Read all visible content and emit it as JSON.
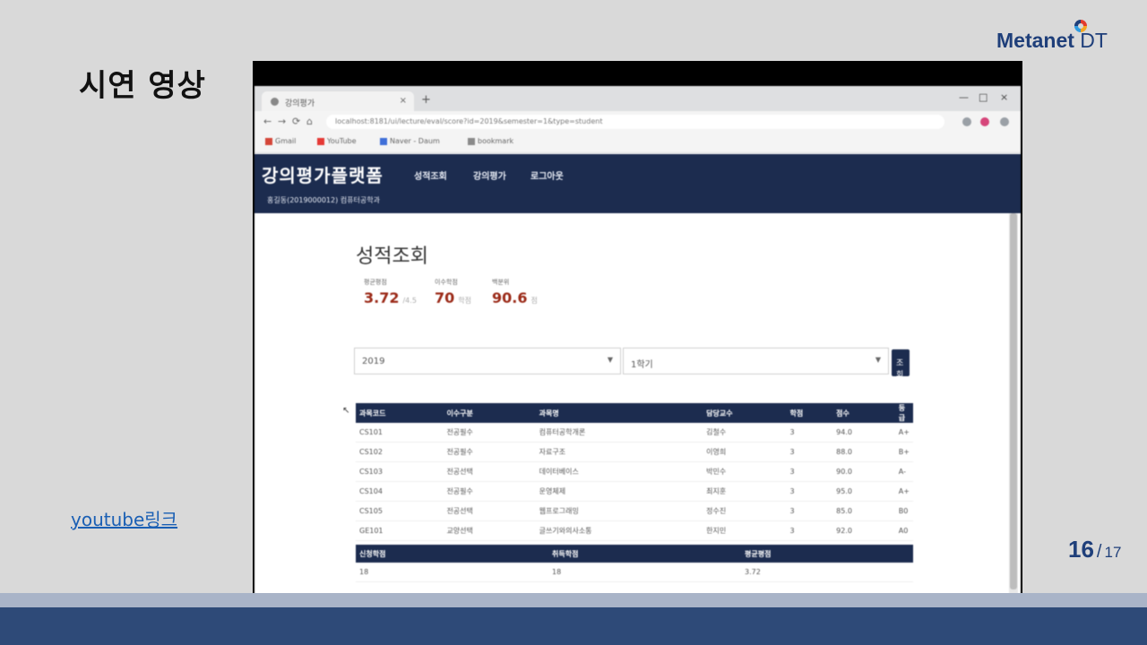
{
  "slide": {
    "title": "시연 영상",
    "link_text": "youtube링크",
    "page_current": "16",
    "page_separator": "/",
    "page_total": "17"
  },
  "logo": {
    "name": "Metanet",
    "suffix": "DT"
  },
  "browser": {
    "tab_title": "강의평가",
    "tab_close": "×",
    "new_tab": "+",
    "window_controls": [
      "—",
      "□",
      "×"
    ],
    "nav_buttons": [
      "←",
      "→",
      "⟳",
      "⌂"
    ],
    "url": "localhost:8181/ui/lecture/eval/score?id=2019&semester=1&type=student",
    "bookmarks": [
      {
        "label": "Gmail",
        "color": "#d44638"
      },
      {
        "label": "YouTube",
        "color": "#e53935"
      },
      {
        "label": "Naver - Daum",
        "color": "#3f6fd8"
      },
      {
        "label": "bookmark",
        "color": "#8a8a8a"
      }
    ],
    "colors": {
      "navbar": "#1c2c4f",
      "accent_value": "#9b2a18"
    }
  },
  "app": {
    "brand": "강의평가플랫폼",
    "nav": [
      "성적조회",
      "강의평가",
      "로그아웃"
    ],
    "user_line": "홍길동(2019000012) 컴퓨터공학과",
    "page_heading": "성적조회",
    "stats": [
      {
        "label": "평균평점",
        "value": "3.72",
        "unit": "/4.5"
      },
      {
        "label": "이수학점",
        "value": "70",
        "unit": "학점"
      },
      {
        "label": "백분위",
        "value": "90.6",
        "unit": "점"
      }
    ],
    "filters": {
      "year": "2019",
      "semester": "1학기",
      "search_label": "조회"
    },
    "grades": {
      "headers": [
        "과목코드",
        "이수구분",
        "과목명",
        "담당교수",
        "학점",
        "점수",
        "등급"
      ],
      "rows": [
        [
          "CS101",
          "전공필수",
          "컴퓨터공학개론",
          "김철수",
          "3",
          "94.0",
          "A+"
        ],
        [
          "CS102",
          "전공필수",
          "자료구조",
          "이영희",
          "3",
          "88.0",
          "B+"
        ],
        [
          "CS103",
          "전공선택",
          "데이터베이스",
          "박민수",
          "3",
          "90.0",
          "A-"
        ],
        [
          "CS104",
          "전공필수",
          "운영체제",
          "최지훈",
          "3",
          "95.0",
          "A+"
        ],
        [
          "CS105",
          "전공선택",
          "웹프로그래밍",
          "정수진",
          "3",
          "85.0",
          "B0"
        ],
        [
          "GE101",
          "교양선택",
          "글쓰기와의사소통",
          "한지민",
          "3",
          "92.0",
          "A0"
        ]
      ]
    },
    "summary": {
      "headers": [
        "신청학점",
        "취득학점",
        "평균평점"
      ],
      "row": [
        "18",
        "18",
        "3.72"
      ]
    }
  }
}
